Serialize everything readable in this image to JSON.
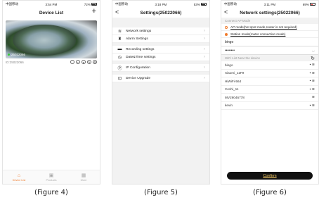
{
  "fig4": {
    "status": {
      "carrier": "中国移动",
      "time": "3:54 PM",
      "battery": "72%"
    },
    "title": "Device List",
    "add_icon": "+",
    "camera": {
      "name": "25022066"
    },
    "device_id": "ID:25022066",
    "tabs": [
      {
        "label": "Device List"
      },
      {
        "label": "Products"
      },
      {
        "label": "More"
      }
    ]
  },
  "fig5": {
    "status": {
      "carrier": "中国移动",
      "time": "3:18 PM",
      "battery": "53%"
    },
    "title": "Settings(25022066)",
    "back": "<",
    "groups": [
      [
        {
          "label": "Network settings",
          "icon": "wifi-icon"
        },
        {
          "label": "Alarm Settings",
          "icon": "alarm-icon"
        }
      ],
      [
        {
          "label": "Recording settings",
          "icon": "record-icon"
        },
        {
          "label": "Date&Time settings",
          "icon": "clock-icon"
        }
      ],
      [
        {
          "label": "IP Configuration",
          "icon": "ip-icon"
        }
      ],
      [
        {
          "label": "Device Upgrade",
          "icon": "upgrade-icon"
        }
      ]
    ]
  },
  "fig6": {
    "status": {
      "carrier": "中国移动",
      "time": "3:11 PM",
      "battery": "69%"
    },
    "title": "Network settings(25022066)",
    "back": "<",
    "connect_section": "Connect AP Mode",
    "ap_mode": "AP mode(hot spot mode,router is not required)",
    "station_mode": "Station mode(router connection mode)",
    "ssid_value": "bingo",
    "password_value": "••••••••",
    "wifi_list_header": "WiFi List Near the device",
    "networks": [
      "bingo",
      "Xiaomi_11F9",
      "HiWiFi-564",
      "Ceshi_11",
      "MV29046778",
      "kevin"
    ],
    "confirm": "Confirm"
  },
  "captions": [
    "(Figure 4)",
    "(Figure 5)",
    "(Figure 6)"
  ]
}
